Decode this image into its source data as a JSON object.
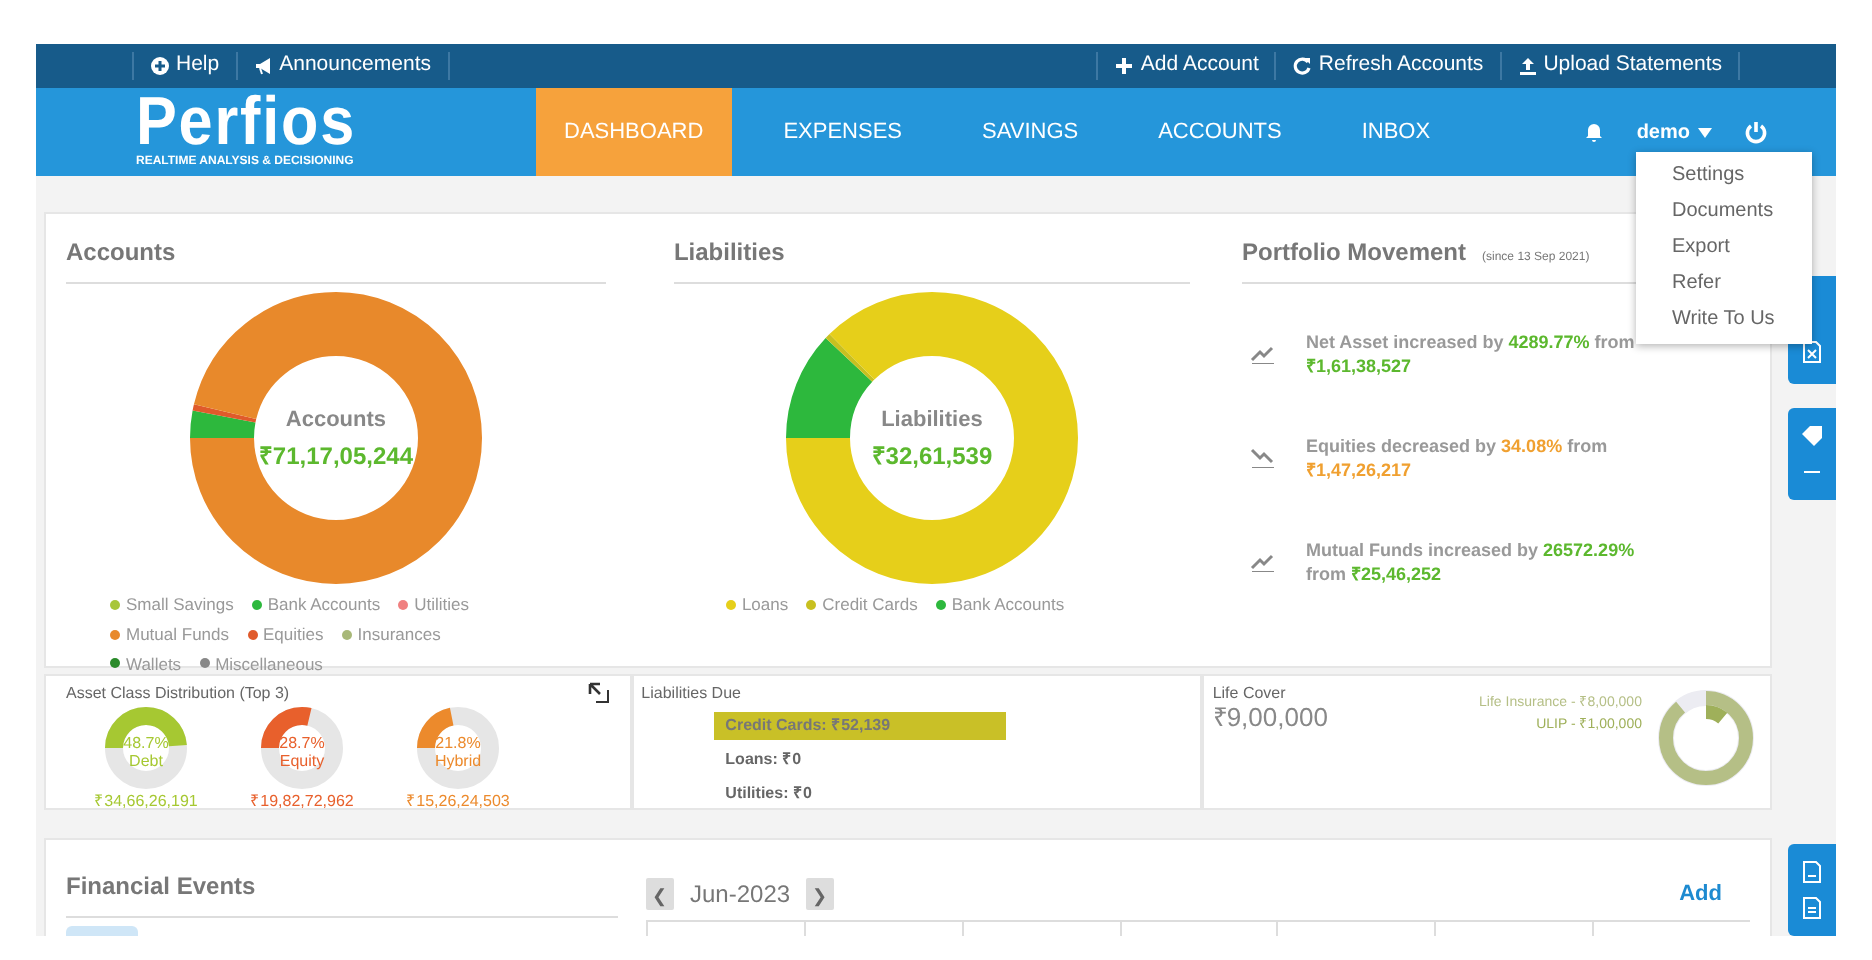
{
  "top_bar": {
    "left_links": [
      {
        "kind": "help",
        "label": "Help"
      },
      {
        "kind": "announce",
        "label": "Announcements"
      }
    ],
    "right_links": [
      {
        "kind": "add",
        "label": "Add Account"
      },
      {
        "kind": "refresh",
        "label": "Refresh Accounts"
      },
      {
        "kind": "upload",
        "label": "Upload Statements"
      }
    ]
  },
  "logo": {
    "name": "Perfios",
    "tagline": "REALTIME ANALYSIS & DECISIONING"
  },
  "nav": [
    {
      "label": "DASHBOARD",
      "selected": true
    },
    {
      "label": "EXPENSES",
      "selected": false
    },
    {
      "label": "SAVINGS",
      "selected": false
    },
    {
      "label": "ACCOUNTS",
      "selected": false
    },
    {
      "label": "INBOX",
      "selected": false
    }
  ],
  "user": {
    "name": "demo",
    "menu": [
      "Settings",
      "Documents",
      "Export",
      "Refer",
      "Write To Us"
    ]
  },
  "accounts": {
    "title": "Accounts",
    "center_label": "Accounts",
    "center_value": "₹71,17,05,244",
    "legend": [
      {
        "label": "Small Savings",
        "color": "#a8c63a"
      },
      {
        "label": "Bank Accounts",
        "color": "#2db83d"
      },
      {
        "label": "Utilities",
        "color": "#f08080"
      },
      {
        "label": "Mutual Funds",
        "color": "#e8892b"
      },
      {
        "label": "Equities",
        "color": "#e05a2b"
      },
      {
        "label": "Insurances",
        "color": "#a8b878"
      },
      {
        "label": "Wallets",
        "color": "#2a8a2a"
      },
      {
        "label": "Miscellaneous",
        "color": "#888888"
      }
    ]
  },
  "liabilities": {
    "title": "Liabilities",
    "center_label": "Liabilities",
    "center_value": "₹32,61,539",
    "legend": [
      {
        "label": "Loans",
        "color": "#e6cf1a"
      },
      {
        "label": "Credit Cards",
        "color": "#c8c020"
      },
      {
        "label": "Bank Accounts",
        "color": "#2db83d"
      }
    ]
  },
  "portfolio": {
    "title": "Portfolio Movement",
    "subtitle": "(since 13 Sep 2021)",
    "items": [
      {
        "kind": "up",
        "prefix": "Net Asset increased by ",
        "change": "4289.77%",
        "suffix": " from",
        "amount": "₹1,61,38,527"
      },
      {
        "kind": "down",
        "prefix": "Equities decreased by ",
        "change": "34.08%",
        "suffix": " from",
        "amount": "₹1,47,26,217"
      },
      {
        "kind": "up",
        "prefix": "Mutual Funds increased by ",
        "change": "26572.29%",
        "suffix": " from",
        "amount": "₹25,46,252"
      }
    ]
  },
  "asset_class": {
    "title": "Asset Class Distribution (Top 3)",
    "gauges": [
      {
        "percent": "48.7%",
        "label": "Debt",
        "value": "₹34,66,26,191",
        "level": 0.487,
        "color": "#a6c832"
      },
      {
        "percent": "28.7%",
        "label": "Equity",
        "value": "₹19,82,72,962",
        "level": 0.287,
        "color": "#e8602c"
      },
      {
        "percent": "21.8%",
        "label": "Hybrid",
        "value": "₹15,26,24,503",
        "level": 0.218,
        "color": "#ec8a2c"
      }
    ]
  },
  "liabilities_due": {
    "title": "Liabilities Due",
    "items": [
      {
        "label": "Credit Cards: ₹52,139",
        "selected": true
      },
      {
        "label": "Loans: ₹0",
        "selected": false
      },
      {
        "label": "Utilities: ₹0",
        "selected": false
      }
    ]
  },
  "life_cover": {
    "title": "Life Cover",
    "value": "₹9,00,000",
    "items": [
      {
        "label": "Life Insurance - ₹8,00,000",
        "color": "#b5bf86",
        "level": 0.889
      },
      {
        "label": "ULIP - ₹1,00,000",
        "color": "#9fb05a",
        "level": 0.111
      }
    ]
  },
  "financial_events": {
    "title": "Financial Events",
    "month": "Jun-2023",
    "add": "Add",
    "prev": "❮",
    "next": "❯"
  }
}
